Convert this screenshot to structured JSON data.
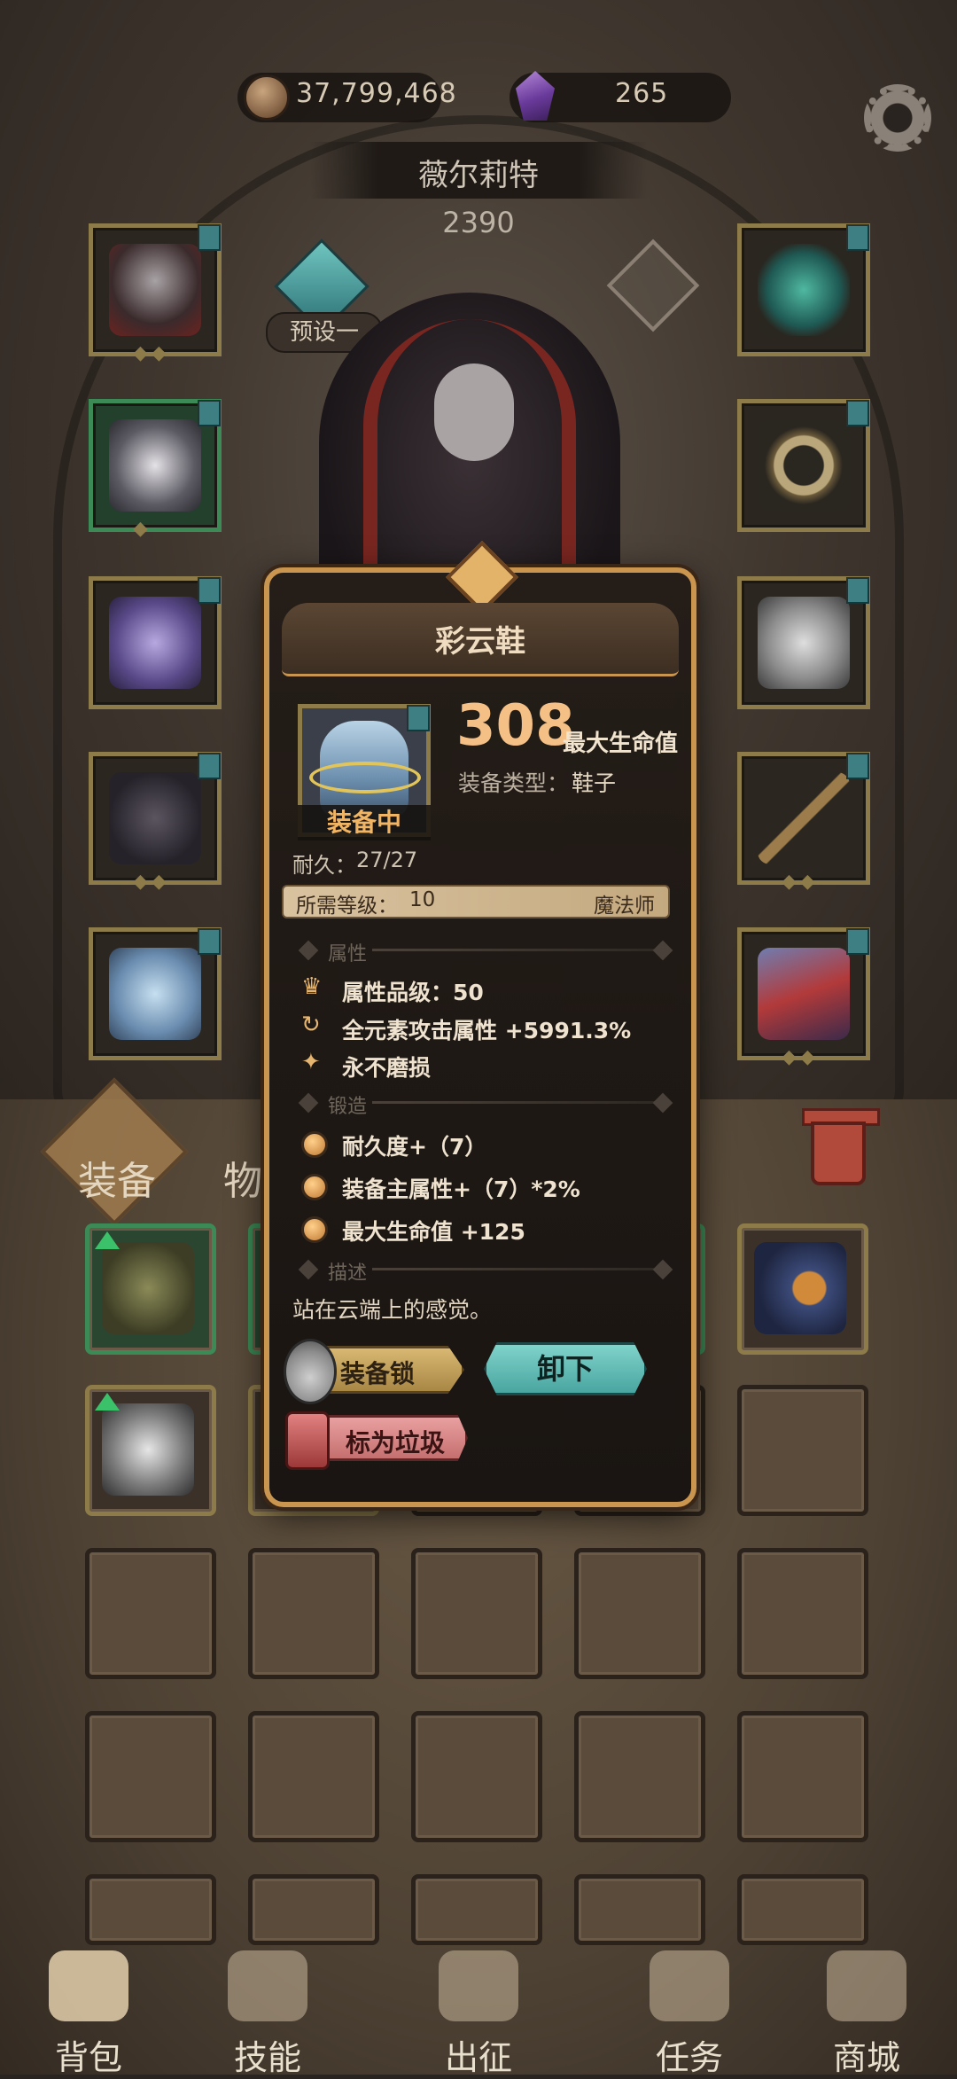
{
  "currency": {
    "gold": "37,799,468",
    "gems": "265"
  },
  "character": {
    "name": "薇尔莉特",
    "power": "2390",
    "preset": "预设一"
  },
  "tabs": {
    "equipment": "装备",
    "items": "物品"
  },
  "popup": {
    "title": "彩云鞋",
    "equipped_badge": "装备中",
    "stat_value": "308",
    "stat_name": "最大生命值",
    "equip_type_label": "装备类型：",
    "equip_type_value": "鞋子",
    "durability_label": "耐久：",
    "durability_value": "27/27",
    "required_level_label": "所需等级：",
    "required_level_value": "10",
    "required_class": "魔法师",
    "attributes_header": "属性",
    "attributes": [
      {
        "icon": "crown-icon",
        "text": "属性品级：50"
      },
      {
        "icon": "cycle-icon",
        "text": "全元素攻击属性 +5991.3%"
      },
      {
        "icon": "sparkle-icon",
        "text": "永不磨损"
      }
    ],
    "forge_header": "锻造",
    "forge": [
      "耐久度+（7）",
      "装备主属性+（7）*2%",
      "最大生命值 +125"
    ],
    "description_header": "描述",
    "description": "站在云端上的感觉。",
    "lock_button": "装备锁",
    "unequip_button": "卸下",
    "junk_button": "标为垃圾"
  },
  "bottom_nav": [
    {
      "label": "背包",
      "icon": "backpack-icon",
      "active": true
    },
    {
      "label": "技能",
      "icon": "skill-book-icon",
      "active": false
    },
    {
      "label": "出征",
      "icon": "sword-icon",
      "active": false
    },
    {
      "label": "任务",
      "icon": "horn-icon",
      "active": false
    },
    {
      "label": "商城",
      "icon": "shop-icon",
      "active": false
    }
  ],
  "colors": {
    "accent_gold": "#c9954f",
    "stat_orange": "#f4c086",
    "unequip_teal": "#7fd3cb",
    "junk_pink": "#e9a0a0"
  }
}
